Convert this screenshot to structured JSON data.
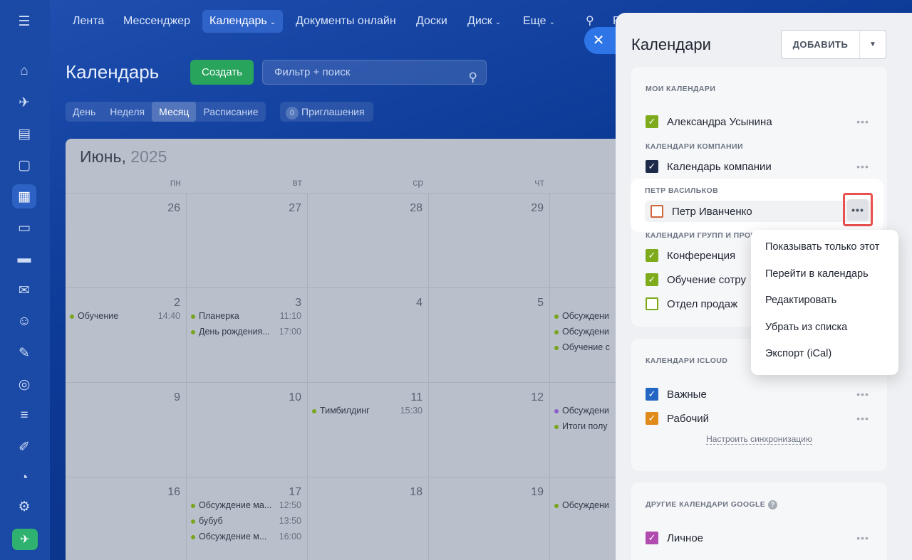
{
  "nav": {
    "items": [
      "Лента",
      "Мессенджер",
      "Календарь",
      "Документы онлайн",
      "Доски",
      "Диск",
      "Еще"
    ],
    "active": "Календарь",
    "partial_label": "R"
  },
  "rail_icons": [
    "menu-icon",
    "home-icon",
    "rocket-icon",
    "tasks-icon",
    "chat-icon",
    "calendar-icon",
    "document-icon",
    "drive-icon",
    "mail-icon",
    "contacts-icon",
    "sign-icon",
    "robot-icon",
    "filter-icon",
    "edit-doc-icon",
    "speed-icon",
    "settings-icon",
    "rocket-icon"
  ],
  "header": {
    "title": "Календарь",
    "create_label": "Создать",
    "search_placeholder": "Фильтр + поиск"
  },
  "views": {
    "tabs": [
      "День",
      "Неделя",
      "Месяц",
      "Расписание"
    ],
    "active": "Месяц",
    "invites_count": "0",
    "invites_label": "Приглашения"
  },
  "calendar": {
    "month": "Июнь,",
    "year": "2025",
    "weekdays": [
      "пн",
      "вт",
      "ср",
      "чт"
    ],
    "weeks": [
      {
        "days": [
          {
            "num": "26",
            "events": []
          },
          {
            "num": "27",
            "events": []
          },
          {
            "num": "28",
            "events": []
          },
          {
            "num": "29",
            "events": []
          },
          {
            "num": "",
            "events": []
          }
        ]
      },
      {
        "days": [
          {
            "num": "2",
            "events": [
              {
                "name": "Обучение",
                "time": "14:40",
                "color": "#78a51c"
              }
            ]
          },
          {
            "num": "3",
            "events": [
              {
                "name": "Планерка",
                "time": "11:10",
                "color": "#78a51c"
              },
              {
                "name": "День рождения...",
                "time": "17:00",
                "color": "#78a51c"
              }
            ]
          },
          {
            "num": "4",
            "events": []
          },
          {
            "num": "5",
            "events": []
          },
          {
            "num": "",
            "events": [
              {
                "name": "Обсуждени",
                "time": "",
                "color": "#78a51c"
              },
              {
                "name": "Обсуждени",
                "time": "",
                "color": "#78a51c"
              },
              {
                "name": "Обучение с",
                "time": "",
                "color": "#78a51c"
              }
            ]
          }
        ]
      },
      {
        "days": [
          {
            "num": "9",
            "events": []
          },
          {
            "num": "10",
            "events": []
          },
          {
            "num": "11",
            "events": [
              {
                "name": "Тимбилдинг",
                "time": "15:30",
                "color": "#78a51c"
              }
            ]
          },
          {
            "num": "12",
            "events": []
          },
          {
            "num": "",
            "events": [
              {
                "name": "Обсуждени",
                "time": "",
                "color": "#8b5fc7"
              },
              {
                "name": "Итоги полу",
                "time": "",
                "color": "#78a51c"
              }
            ]
          }
        ]
      },
      {
        "days": [
          {
            "num": "16",
            "events": []
          },
          {
            "num": "17",
            "events": [
              {
                "name": "Обсуждение ма...",
                "time": "12:50",
                "color": "#78a51c"
              },
              {
                "name": "бубуб",
                "time": "13:50",
                "color": "#78a51c"
              },
              {
                "name": "Обсуждение м...",
                "time": "16:00",
                "color": "#78a51c"
              }
            ]
          },
          {
            "num": "18",
            "events": []
          },
          {
            "num": "19",
            "events": []
          },
          {
            "num": "",
            "events": [
              {
                "name": "Обсуждени",
                "time": "",
                "color": "#78a51c"
              }
            ]
          }
        ]
      }
    ]
  },
  "drawer": {
    "title": "Календари",
    "add_label": "ДОБАВИТЬ",
    "my_calendars": {
      "heading": "МОИ КАЛЕНДАРИ",
      "items": [
        {
          "label": "Александра Усынина",
          "color": "#7dab1c",
          "checked": true
        }
      ]
    },
    "company_calendars": {
      "heading": "КАЛЕНДАРИ КОМПАНИИ",
      "items": [
        {
          "label": "Календарь компании",
          "color": "#1d2a4a",
          "checked": true
        }
      ]
    },
    "petr_section": {
      "heading": "ПЕТР ВАСИЛЬКОВ",
      "items": [
        {
          "label": "Петр Иванченко",
          "color": "#d0663a",
          "checked": false
        }
      ]
    },
    "group_calendars": {
      "heading": "КАЛЕНДАРИ ГРУПП И ПРОЕ",
      "items": [
        {
          "label": "Конференция",
          "color": "#7dab1c",
          "checked": true
        },
        {
          "label": "Обучение сотру",
          "color": "#7dab1c",
          "checked": true
        },
        {
          "label": "Отдел продаж",
          "color": "#7dab1c",
          "checked": false
        }
      ]
    },
    "icloud": {
      "heading": "КАЛЕНДАРИ ICLOUD",
      "items": [
        {
          "label": "Важные",
          "color": "#2466c4",
          "checked": true
        },
        {
          "label": "Рабочий",
          "color": "#e08a1c",
          "checked": true
        }
      ],
      "sync_link": "Настроить синхронизацию"
    },
    "google": {
      "heading": "ДРУГИЕ КАЛЕНДАРИ GOOGLE",
      "items": [
        {
          "label": "Личное",
          "color": "#b04bb0",
          "checked": true
        }
      ]
    }
  },
  "context_menu": {
    "items": [
      "Показывать только этот",
      "Перейти в календарь",
      "Редактировать",
      "Убрать из списка",
      "Экспорт (iCal)"
    ]
  }
}
